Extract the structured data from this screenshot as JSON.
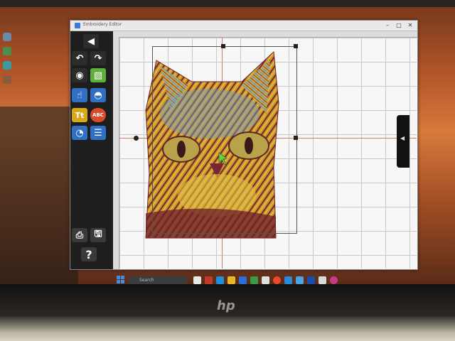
{
  "window": {
    "title": "Embroidery Editor"
  },
  "toolbar": {
    "tools": [
      {
        "name": "back-arrow",
        "glyph": "🡄"
      },
      {
        "name": "undo",
        "glyph": "↶"
      },
      {
        "name": "redo",
        "glyph": "↷"
      },
      {
        "name": "view",
        "glyph": "◉"
      },
      {
        "name": "image",
        "glyph": "▧"
      },
      {
        "name": "select",
        "glyph": "☝"
      },
      {
        "name": "shape",
        "glyph": "◓"
      },
      {
        "name": "text",
        "glyph": "Tt"
      },
      {
        "name": "monogram",
        "glyph": "ABC"
      },
      {
        "name": "palette",
        "glyph": "◔"
      },
      {
        "name": "layers",
        "glyph": "☰"
      },
      {
        "name": "print",
        "glyph": "⎙"
      },
      {
        "name": "save",
        "glyph": "🖫"
      },
      {
        "name": "help",
        "glyph": "?"
      }
    ]
  },
  "canvas": {
    "design": "cat-face-embroidery",
    "grid": true
  },
  "side_panel": {
    "toggle_glyph": "◀"
  },
  "taskbar": {
    "search_placeholder": "Search",
    "apps": [
      "file-explorer",
      "store",
      "edge",
      "mail",
      "photos",
      "chrome",
      "settings",
      "calculator",
      "media"
    ]
  },
  "brand": {
    "logo_text": "hp"
  },
  "colors": {
    "toolbar_bg": "#1e1e1e",
    "canvas_bg": "#f7f7f7",
    "guide_line": "#d8786c",
    "embroidery_gold": "#d9a72a",
    "embroidery_maroon": "#6e1e2a",
    "embroidery_blue": "#6f9fc6"
  }
}
